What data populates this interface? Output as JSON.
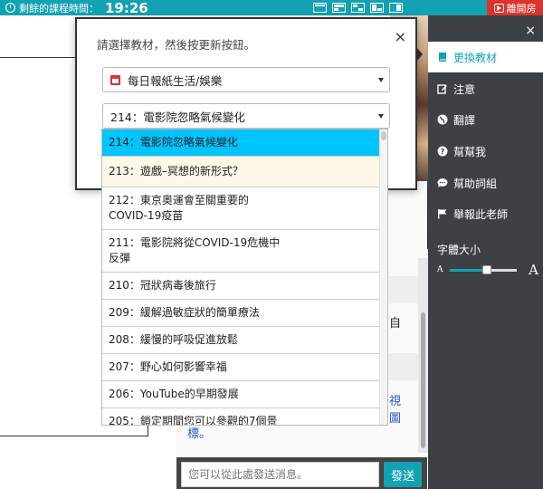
{
  "topbar": {
    "timer_label": "剩餘的課程時間：",
    "timer_value": "19:26",
    "leave_label": "離開房"
  },
  "modal": {
    "instruction": "請選擇教材，然後按更新按鈕。",
    "close": "×",
    "category_select": "每日報紙生活/娛樂",
    "lesson_select": "214：電影院忽略氣候變化"
  },
  "dropdown": {
    "items": [
      "214：電影院忽略氣候變化",
      "213：遊戲–冥想的新形式？",
      "212：東京奧運會至關重要的COVID-19疫苗",
      "211：電影院將從COVID-19危機中反彈",
      "210：冠狀病毒後旅行",
      "209：緩解過敏症狀的簡單療法",
      "208：緩慢的呼吸促進放鬆",
      "207：野心如何影響幸福",
      "206：YouTube的早期發展",
      "205：鎖定期間您可以參觀的7個景"
    ]
  },
  "sidebar": {
    "close": "×",
    "items": [
      {
        "label": "更換教材",
        "icon": "book-icon"
      },
      {
        "label": "注意",
        "icon": "edit-icon"
      },
      {
        "label": "翻譯",
        "icon": "globe-icon"
      },
      {
        "label": "幫幫我",
        "icon": "question-icon"
      },
      {
        "label": "幫助詞組",
        "icon": "chat-icon"
      },
      {
        "label": "舉報此老師",
        "icon": "flag-icon"
      }
    ],
    "font_size_label": "字體大小",
    "font_small": "A",
    "font_large": "A",
    "font_size_level": 0.55
  },
  "chat": {
    "msg_char": "自",
    "link_1": "視",
    "link_2": "圖",
    "link_3": "標。",
    "input_placeholder": "您可以從此處發送消息。",
    "send_label": "發送"
  },
  "colors": {
    "accent": "#13a2b3",
    "danger": "#d9342b",
    "selected": "#00c4ff",
    "sidebar_bg": "#3d4044"
  }
}
